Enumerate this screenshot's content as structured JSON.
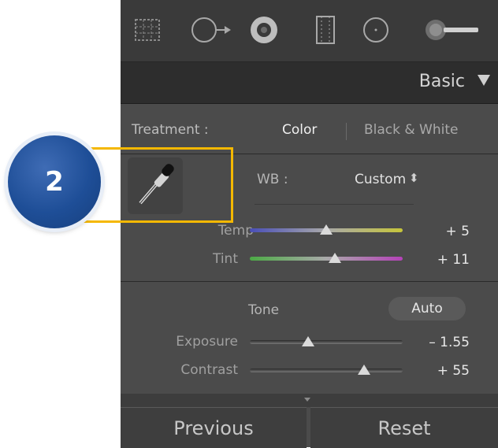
{
  "toolstrip": {
    "tools": [
      {
        "icon": "crop-overlay-icon"
      },
      {
        "icon": "spot-removal-icon"
      },
      {
        "icon": "red-eye-icon"
      },
      {
        "icon": "graduated-filter-icon"
      },
      {
        "icon": "radial-filter-icon"
      },
      {
        "icon": "adjustment-brush-icon"
      }
    ]
  },
  "header": {
    "title": "Basic"
  },
  "treatment": {
    "label": "Treatment :",
    "color": "Color",
    "bw": "Black & White"
  },
  "wb": {
    "label": "WB :",
    "value": "Custom",
    "arrows": "⬍"
  },
  "temp": {
    "label": "Temp",
    "value": "+ 5",
    "position": 0.5
  },
  "tint": {
    "label": "Tint",
    "value": "+ 11",
    "position": 0.56
  },
  "tone": {
    "label": "Tone",
    "auto": "Auto"
  },
  "exposure": {
    "label": "Exposure",
    "value": "– 1.55",
    "position": 0.38
  },
  "contrast": {
    "label": "Contrast",
    "value": "+ 55",
    "position": 0.75
  },
  "buttons": {
    "previous": "Previous",
    "reset": "Reset"
  },
  "callout": {
    "number": "2",
    "color": "#f5b800"
  }
}
